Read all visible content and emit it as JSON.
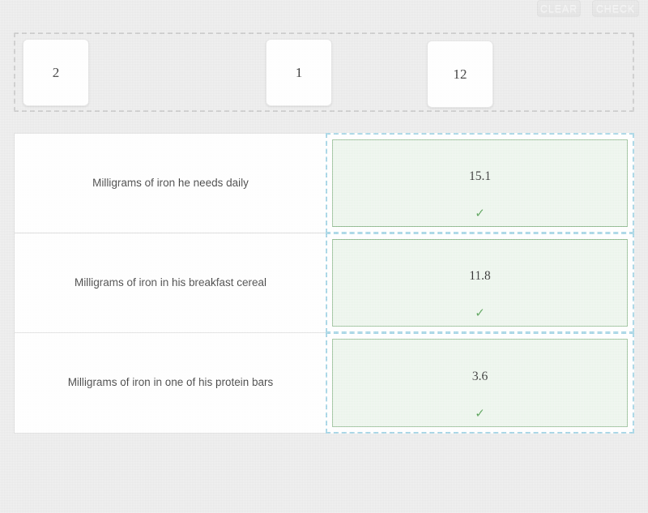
{
  "toolbar": {
    "clear_label": "CLEAR",
    "check_label": "CHECK"
  },
  "tile_tray": {
    "tiles": [
      {
        "value": "2"
      },
      {
        "value": "1"
      },
      {
        "value": "12"
      }
    ]
  },
  "match_table": {
    "rows": [
      {
        "prompt": "Milligrams of iron he needs daily",
        "answer": "15.1",
        "check_icon": "✓",
        "status": "correct"
      },
      {
        "prompt": "Milligrams of iron in his breakfast cereal",
        "answer": "11.8",
        "check_icon": "✓",
        "status": "correct"
      },
      {
        "prompt": "Milligrams of iron in one of his protein bars",
        "answer": "3.6",
        "check_icon": "✓",
        "status": "correct"
      }
    ]
  },
  "colors": {
    "page_background": "#eaeaea",
    "answer_fill": "#ecf5ec",
    "answer_border": "#8fba8f",
    "check_green": "#4a9a4a",
    "drop_zone_border": "#9ed2e4",
    "tray_border": "#c9c9c9"
  }
}
